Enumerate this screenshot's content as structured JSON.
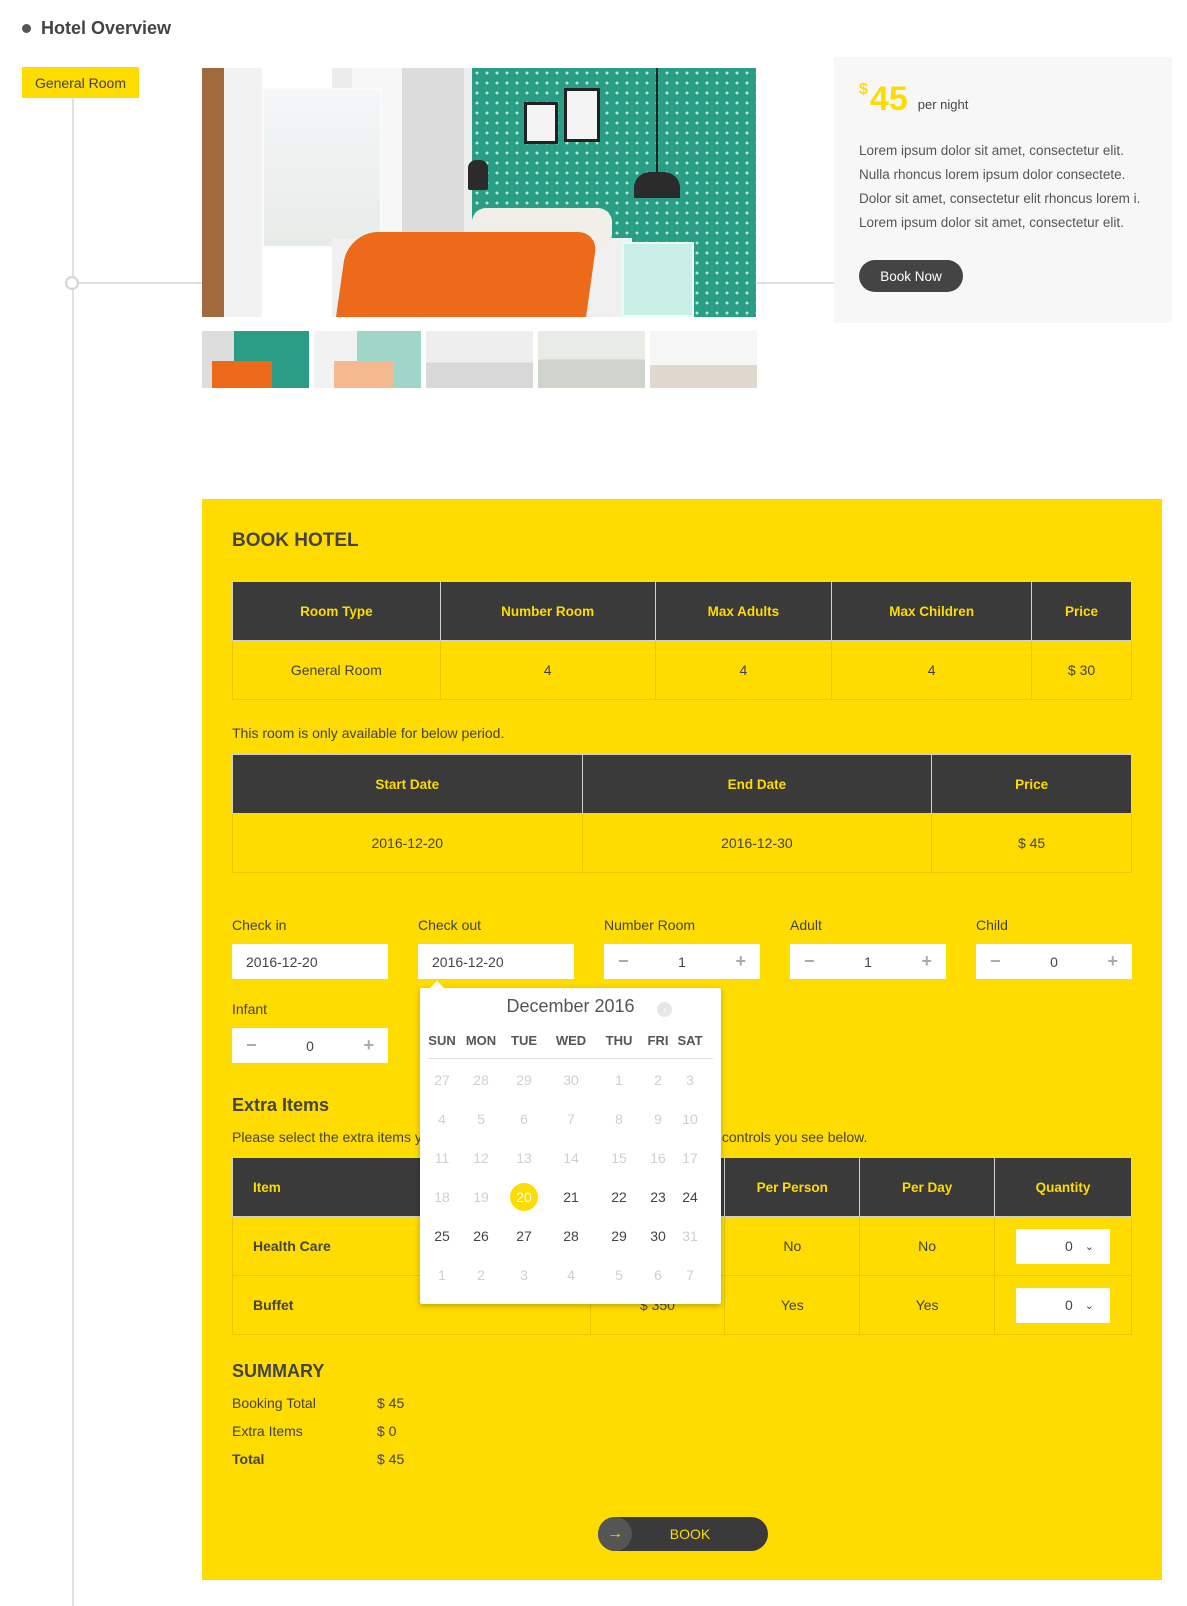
{
  "overview": {
    "title": "Hotel Overview"
  },
  "room_badge": "General Room",
  "price_card": {
    "currency": "$",
    "amount": "45",
    "per": "per night",
    "description": "Lorem ipsum dolor sit amet, consectetur elit. Nulla rhoncus lorem ipsum dolor consectete. Dolor sit amet, consectetur elit rhoncus lorem i. Lorem ipsum dolor sit amet, consectetur elit.",
    "button": "Book Now"
  },
  "booking": {
    "title": "BOOK HOTEL",
    "room_table": {
      "headers": [
        "Room Type",
        "Number Room",
        "Max Adults",
        "Max Children",
        "Price"
      ],
      "row": [
        "General Room",
        "4",
        "4",
        "4",
        "$ 30"
      ]
    },
    "availability_note": "This room is only available for below period.",
    "period_table": {
      "headers": [
        "Start Date",
        "End Date",
        "Price"
      ],
      "row": [
        "2016-12-20",
        "2016-12-30",
        "$ 45"
      ]
    },
    "fields": {
      "check_in": {
        "label": "Check in",
        "value": "2016-12-20"
      },
      "check_out": {
        "label": "Check out",
        "value": "2016-12-20"
      },
      "number_room": {
        "label": "Number Room",
        "value": "1"
      },
      "adult": {
        "label": "Adult",
        "value": "1"
      },
      "child": {
        "label": "Child",
        "value": "0"
      },
      "infant": {
        "label": "Infant",
        "value": "0"
      }
    },
    "extra": {
      "title": "Extra Items",
      "note_start": "Please select the extra items y",
      "note_end": "controls you see below.",
      "headers": [
        "Item",
        "",
        "Per Person",
        "Per Day",
        "Quantity"
      ],
      "rows": [
        {
          "item": "Health Care",
          "price": "",
          "per_person": "No",
          "per_day": "No",
          "quantity": "0"
        },
        {
          "item": "Buffet",
          "price": "$ 350",
          "per_person": "Yes",
          "per_day": "Yes",
          "quantity": "0"
        }
      ]
    },
    "summary": {
      "title": "SUMMARY",
      "booking_total_label": "Booking Total",
      "booking_total": "$ 45",
      "extra_items_label": "Extra Items",
      "extra_items": "$ 0",
      "total_label": "Total",
      "total": "$ 45"
    },
    "book_button": "BOOK"
  },
  "calendar": {
    "month": "December 2016",
    "dows": [
      "SUN",
      "MON",
      "TUE",
      "WED",
      "THU",
      "FRI",
      "SAT"
    ],
    "weeks": [
      [
        "27",
        "28",
        "29",
        "30",
        "1",
        "2",
        "3"
      ],
      [
        "4",
        "5",
        "6",
        "7",
        "8",
        "9",
        "10"
      ],
      [
        "11",
        "12",
        "13",
        "14",
        "15",
        "16",
        "17"
      ],
      [
        "18",
        "19",
        "20",
        "21",
        "22",
        "23",
        "24"
      ],
      [
        "25",
        "26",
        "27",
        "28",
        "29",
        "30",
        "31"
      ],
      [
        "1",
        "2",
        "3",
        "4",
        "5",
        "6",
        "7"
      ]
    ],
    "enabled_from": [
      3,
      2
    ],
    "enabled_to": [
      4,
      5
    ],
    "selected": [
      3,
      2
    ]
  },
  "colors": {
    "accent": "#fedc00",
    "dark": "#3a3a3a"
  }
}
